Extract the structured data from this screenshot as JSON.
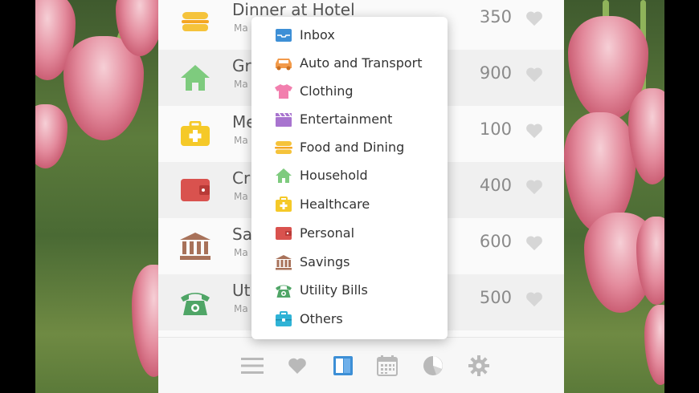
{
  "transactions": [
    {
      "title": "Dinner at Hotel",
      "subtitle": "Ma",
      "amount": "350",
      "icon": "food-icon",
      "color": "#f5c33b"
    },
    {
      "title": "Gr",
      "subtitle": "Ma",
      "amount": "900",
      "icon": "house-icon",
      "color": "#7ecb7e"
    },
    {
      "title": "Me",
      "subtitle": "Ma",
      "amount": "100",
      "icon": "medkit-icon",
      "color": "#f5c928"
    },
    {
      "title": "Cr",
      "subtitle": "Ma",
      "amount": "400",
      "icon": "wallet-icon",
      "color": "#d9524e"
    },
    {
      "title": "Sa",
      "subtitle": "Ma",
      "amount": "600",
      "icon": "bank-icon",
      "color": "#a8725a"
    },
    {
      "title": "Uti",
      "subtitle": "Ma",
      "amount": "500",
      "icon": "telephone-icon",
      "color": "#4fa566"
    }
  ],
  "category_menu": [
    {
      "label": "Inbox",
      "icon": "inbox-icon",
      "color": "#3d8fd6"
    },
    {
      "label": "Auto and Transport",
      "icon": "car-icon",
      "color": "#f29a4a"
    },
    {
      "label": "Clothing",
      "icon": "tshirt-icon",
      "color": "#f27fae"
    },
    {
      "label": "Entertainment",
      "icon": "clapperboard-icon",
      "color": "#a874cf"
    },
    {
      "label": "Food and Dining",
      "icon": "burger-icon",
      "color": "#f5c33b"
    },
    {
      "label": "Household",
      "icon": "house-icon",
      "color": "#7ecb7e"
    },
    {
      "label": "Healthcare",
      "icon": "medkit-icon",
      "color": "#f5c928"
    },
    {
      "label": "Personal",
      "icon": "wallet-icon",
      "color": "#d9524e"
    },
    {
      "label": "Savings",
      "icon": "bank-icon",
      "color": "#a8725a"
    },
    {
      "label": "Utility Bills",
      "icon": "telephone-icon",
      "color": "#4fa566"
    },
    {
      "label": "Others",
      "icon": "briefcase-icon",
      "color": "#2fb3d6"
    }
  ],
  "tabbar": [
    {
      "icon": "menu-icon",
      "active": false
    },
    {
      "icon": "heart-icon",
      "active": false
    },
    {
      "icon": "book-icon",
      "active": true
    },
    {
      "icon": "calendar-icon",
      "active": false
    },
    {
      "icon": "pie-chart-icon",
      "active": false
    },
    {
      "icon": "gear-icon",
      "active": false
    }
  ],
  "colors": {
    "accent": "#3d8fd6",
    "inactive_icon": "#b9b9b9",
    "heart": "#d6d6d6"
  }
}
